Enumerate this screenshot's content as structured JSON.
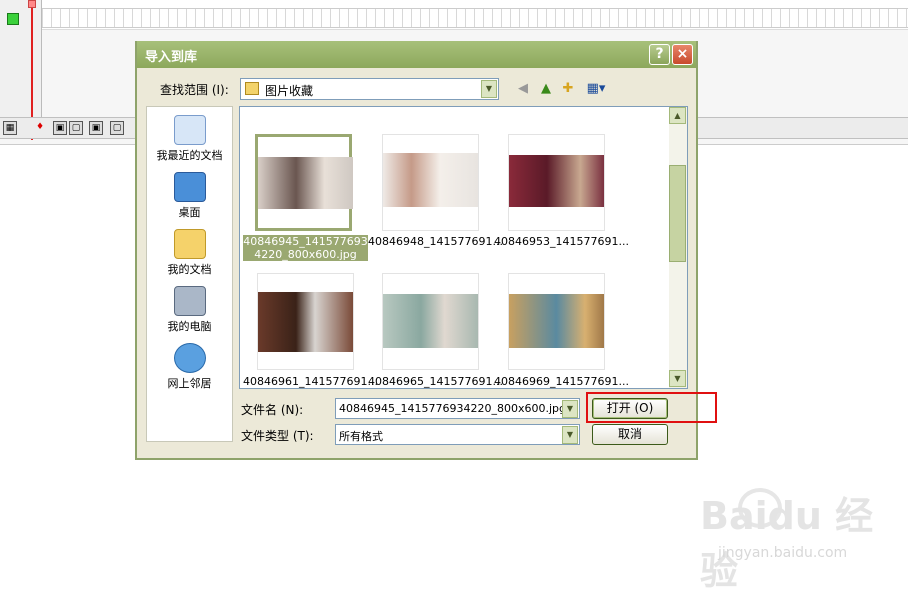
{
  "dialog": {
    "title": "导入到库",
    "help_label": "?",
    "close_label": "×",
    "lookin_label": "查找范围 (I):",
    "lookin_value": "图片收藏",
    "places": [
      {
        "label": "我最近的文档",
        "icon": "recent-documents-icon"
      },
      {
        "label": "桌面",
        "icon": "desktop-icon"
      },
      {
        "label": "我的文档",
        "icon": "my-documents-icon"
      },
      {
        "label": "我的电脑",
        "icon": "my-computer-icon"
      },
      {
        "label": "网上邻居",
        "icon": "network-places-icon"
      }
    ],
    "files": [
      {
        "name": "40846945_1415776934220_800x600.jpg",
        "selected": true
      },
      {
        "name": "40846948_141577691...",
        "selected": false
      },
      {
        "name": "40846953_141577691...",
        "selected": false
      },
      {
        "name": "40846961_141577691...",
        "selected": false
      },
      {
        "name": "40846965_141577691...",
        "selected": false
      },
      {
        "name": "40846969_141577691...",
        "selected": false
      }
    ],
    "filename_label": "文件名 (N):",
    "filename_value": "40846945_1415776934220_800x600.jpg",
    "filetype_label": "文件类型 (T):",
    "filetype_value": "所有格式",
    "open_label": "打开 (O)",
    "cancel_label": "取消"
  },
  "watermark": {
    "logo": "Baidu 经验",
    "url": "jingyan.baidu.com"
  },
  "colors": {
    "title_bar": "#8da85c",
    "highlight_box": "#e01010",
    "selection": "#9aa871"
  }
}
